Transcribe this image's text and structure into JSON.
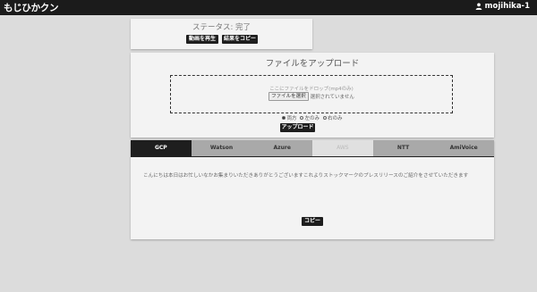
{
  "app": {
    "title": "もじひかクン"
  },
  "user": {
    "name": "mojihika-1",
    "icon": "user-icon"
  },
  "status": {
    "text": "ステータス: 完了",
    "play_label": "動画を再生",
    "copy_result_label": "結果をコピー"
  },
  "upload": {
    "title": "ファイルをアップロード",
    "drop_hint": "ここにファイルをドロップ(mp4のみ)",
    "choose_label": "ファイルを選択",
    "no_file_label": "選択されていません",
    "radio_options": [
      {
        "label": "両方",
        "checked": true
      },
      {
        "label": "左のみ",
        "checked": false
      },
      {
        "label": "右のみ",
        "checked": false
      }
    ],
    "upload_label": "アップロード"
  },
  "result": {
    "tabs": [
      {
        "label": "GCP",
        "state": "active"
      },
      {
        "label": "Watson",
        "state": "normal"
      },
      {
        "label": "Azure",
        "state": "normal"
      },
      {
        "label": "AWS",
        "state": "disabled"
      },
      {
        "label": "NTT",
        "state": "normal"
      },
      {
        "label": "AmiVoice",
        "state": "normal"
      }
    ],
    "text": "こんにちは本日はお忙しいなかお集まりいただきありがとうございますこれよりストックマークのプレスリリースのご紹介をさせていただきます",
    "copy_label": "コピー"
  }
}
